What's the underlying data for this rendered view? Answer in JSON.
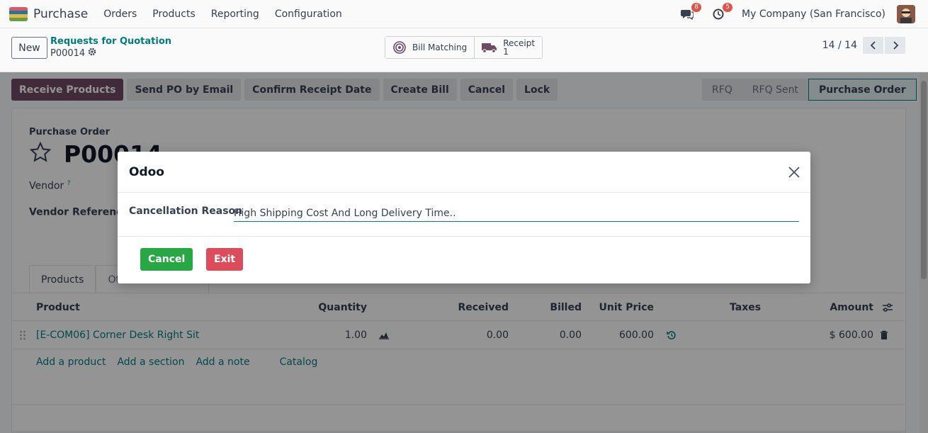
{
  "topbar": {
    "app_name": "Purchase",
    "menu": [
      "Orders",
      "Products",
      "Reporting",
      "Configuration"
    ],
    "messages_count": "8",
    "activities_count": "5",
    "company": "My Company (San Francisco)",
    "logo_colors": [
      "#e6566f",
      "#1f7e9a",
      "#f1b94b",
      "#65a346"
    ]
  },
  "control": {
    "new_label": "New",
    "breadcrumb_parent": "Requests for Quotation",
    "breadcrumb_current": "P00014",
    "smart_buttons": {
      "bill_matching": "Bill Matching",
      "receipt_label": "Receipt",
      "receipt_count": "1"
    },
    "pager": "14 / 14"
  },
  "actions": {
    "receive_products": "Receive Products",
    "send_po": "Send PO by Email",
    "confirm_receipt": "Confirm Receipt Date",
    "create_bill": "Create Bill",
    "cancel": "Cancel",
    "lock": "Lock"
  },
  "status_bar": {
    "stages": [
      "RFQ",
      "RFQ Sent",
      "Purchase Order"
    ],
    "active": "Purchase Order"
  },
  "form": {
    "type_label": "Purchase Order",
    "name": "P00014",
    "vendor_label": "Vendor",
    "vendor_ref_label": "Vendor Reference",
    "help_mark": "?",
    "tabs": [
      "Products",
      "Other Information"
    ]
  },
  "table": {
    "headers": {
      "product": "Product",
      "quantity": "Quantity",
      "received": "Received",
      "billed": "Billed",
      "unit_price": "Unit Price",
      "taxes": "Taxes",
      "amount": "Amount"
    },
    "rows": [
      {
        "product": "[E-COM06] Corner Desk Right Sit",
        "quantity": "1.00",
        "received": "0.00",
        "billed": "0.00",
        "unit_price": "600.00",
        "taxes": "",
        "amount": "$ 600.00"
      }
    ],
    "links": [
      "Add a product",
      "Add a section",
      "Add a note",
      "Catalog"
    ]
  },
  "dialog": {
    "title": "Odoo",
    "reason_label": "Cancellation Reason",
    "reason_value": "High Shipping Cost And Long Delivery Time..",
    "confirm_label": "Cancel",
    "exit_label": "Exit"
  },
  "colors": {
    "brand": "#714b67",
    "link": "#017e84",
    "success": "#28a745",
    "danger": "#dc4c5a"
  }
}
